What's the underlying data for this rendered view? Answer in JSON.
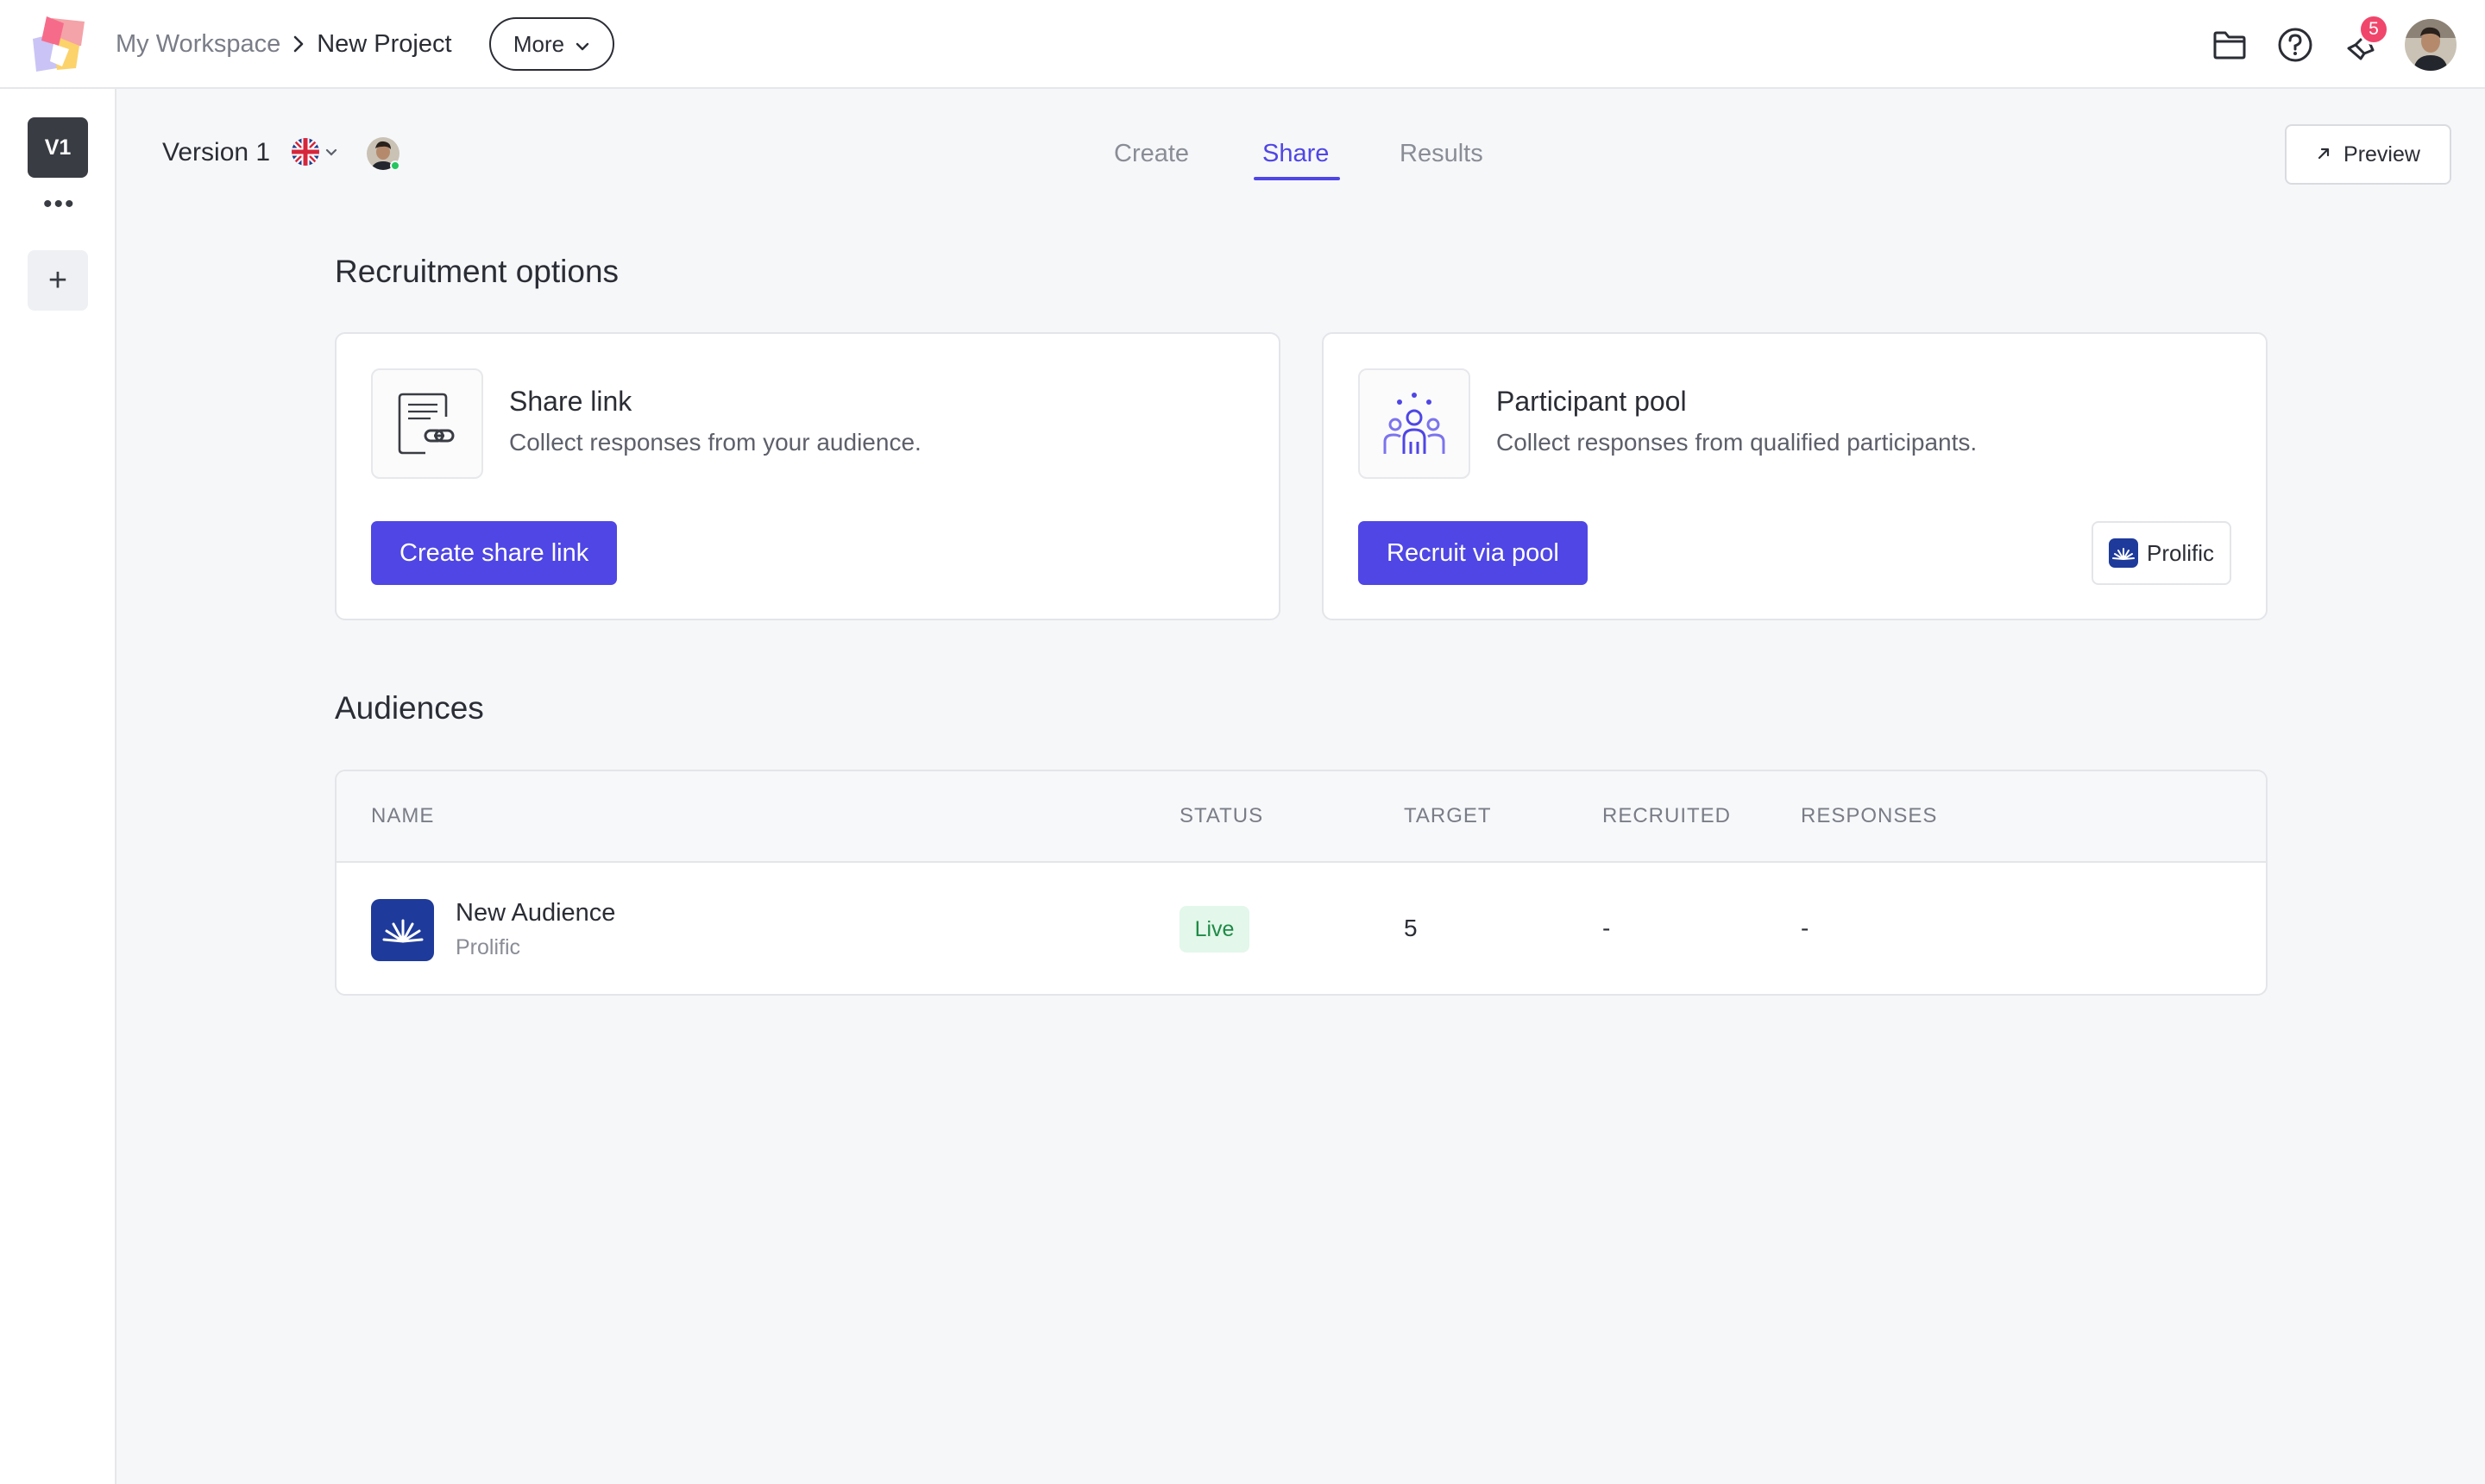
{
  "topbar": {
    "breadcrumb": {
      "workspace": "My Workspace",
      "project": "New Project"
    },
    "more_label": "More",
    "notification_count": "5",
    "icons": [
      "folder-icon",
      "help-icon",
      "announcements-icon"
    ]
  },
  "rail": {
    "version_chip": "V1",
    "more_dots": "•••",
    "add_label": "+"
  },
  "subheader": {
    "version_label": "Version 1",
    "language": "flag-uk-icon",
    "tabs": [
      {
        "label": "Create",
        "active": false
      },
      {
        "label": "Share",
        "active": true
      },
      {
        "label": "Results",
        "active": false
      }
    ],
    "preview_label": "Preview"
  },
  "recruitment": {
    "title": "Recruitment options",
    "share_link": {
      "title": "Share link",
      "description": "Collect responses from your audience.",
      "button": "Create share link"
    },
    "participant_pool": {
      "title": "Participant pool",
      "description": "Collect responses from qualified participants.",
      "button": "Recruit via pool",
      "provider": "Prolific"
    }
  },
  "audiences": {
    "title": "Audiences",
    "columns": [
      "NAME",
      "STATUS",
      "TARGET",
      "RECRUITED",
      "RESPONSES"
    ],
    "rows": [
      {
        "name": "New Audience",
        "provider": "Prolific",
        "status": "Live",
        "target": "5",
        "recruited": "-",
        "responses": "-"
      }
    ]
  },
  "colors": {
    "accent": "#4f46e5",
    "prolific_blue": "#1e3a9b",
    "live_bg": "#e3f7ea",
    "live_text": "#1f8a47",
    "badge": "#f0466b"
  }
}
